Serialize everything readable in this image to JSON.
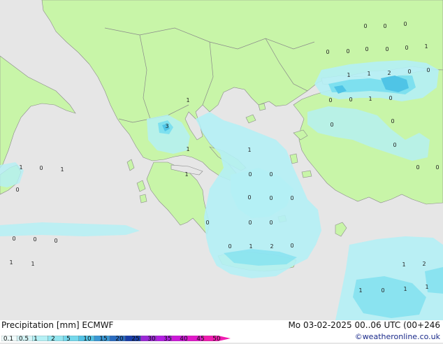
{
  "map": {
    "colors": {
      "sea": "#e6e6e6",
      "land": "#c8f5a8",
      "border": "#8a8a8a",
      "precip_light": "#b4f0f5",
      "precip_mid": "#7ee0ef",
      "precip_heavy": "#4fc4e6"
    },
    "point_values": [
      {
        "id": "p1",
        "v": "0"
      },
      {
        "id": "p2",
        "v": "0"
      },
      {
        "id": "p3",
        "v": "0"
      },
      {
        "id": "p4",
        "v": "0"
      },
      {
        "id": "p5",
        "v": "0"
      },
      {
        "id": "p6",
        "v": "0"
      },
      {
        "id": "p7",
        "v": "0"
      },
      {
        "id": "p8",
        "v": "0"
      },
      {
        "id": "p9",
        "v": "1"
      },
      {
        "id": "p10",
        "v": "2"
      },
      {
        "id": "p11",
        "v": "0"
      },
      {
        "id": "p12",
        "v": "0"
      },
      {
        "id": "p13",
        "v": "1"
      },
      {
        "id": "p14",
        "v": "1"
      },
      {
        "id": "p15",
        "v": "0"
      },
      {
        "id": "p16",
        "v": "0"
      },
      {
        "id": "p17",
        "v": "3"
      },
      {
        "id": "p18",
        "v": "1"
      },
      {
        "id": "p19",
        "v": "0"
      },
      {
        "id": "p20",
        "v": "1"
      },
      {
        "id": "p21",
        "v": "0"
      },
      {
        "id": "p22",
        "v": "0"
      },
      {
        "id": "p23",
        "v": "1"
      },
      {
        "id": "p24",
        "v": "1"
      },
      {
        "id": "p25",
        "v": "1"
      },
      {
        "id": "p26",
        "v": "0"
      },
      {
        "id": "p27",
        "v": "1"
      },
      {
        "id": "p28",
        "v": "0"
      },
      {
        "id": "p29",
        "v": "0"
      },
      {
        "id": "p30",
        "v": "0"
      },
      {
        "id": "p31",
        "v": "1"
      },
      {
        "id": "p32",
        "v": "0"
      },
      {
        "id": "p33",
        "v": "0"
      },
      {
        "id": "p34",
        "v": "0"
      },
      {
        "id": "p35",
        "v": "0"
      },
      {
        "id": "p36",
        "v": "0"
      },
      {
        "id": "p37",
        "v": "0"
      },
      {
        "id": "p38",
        "v": "0"
      },
      {
        "id": "p39",
        "v": "0"
      },
      {
        "id": "p40",
        "v": "0"
      },
      {
        "id": "p41",
        "v": "0"
      },
      {
        "id": "p42",
        "v": "0"
      },
      {
        "id": "p43",
        "v": "0"
      },
      {
        "id": "p44",
        "v": "0"
      },
      {
        "id": "p45",
        "v": "1"
      },
      {
        "id": "p46",
        "v": "2"
      },
      {
        "id": "p47",
        "v": "0"
      },
      {
        "id": "p48",
        "v": "1"
      },
      {
        "id": "p49",
        "v": "1"
      },
      {
        "id": "p50",
        "v": "1"
      },
      {
        "id": "p51",
        "v": "2"
      },
      {
        "id": "p52",
        "v": "1"
      },
      {
        "id": "p53",
        "v": "0"
      },
      {
        "id": "p54",
        "v": "1"
      },
      {
        "id": "p55",
        "v": "1"
      }
    ]
  },
  "footer": {
    "title": "Precipitation [mm]  ECMWF",
    "date_line": "Mo 03-02-2025 00..06 UTC (00+246",
    "credit": "©weatheronline.co.uk"
  },
  "legend": {
    "ticks": [
      "0.1",
      "0.5",
      "1",
      "2",
      "5",
      "10",
      "15",
      "20",
      "25",
      "30",
      "35",
      "40",
      "45",
      "50"
    ],
    "colors": [
      "#f0fcfc",
      "#d6f6f8",
      "#b4f0f5",
      "#94e6f0",
      "#74d8ec",
      "#52c2e4",
      "#3a98d4",
      "#2a6cc0",
      "#1a3ea8",
      "#9a28d6",
      "#b21ee2",
      "#cc18d8",
      "#e018c8",
      "#f01cb0"
    ]
  }
}
